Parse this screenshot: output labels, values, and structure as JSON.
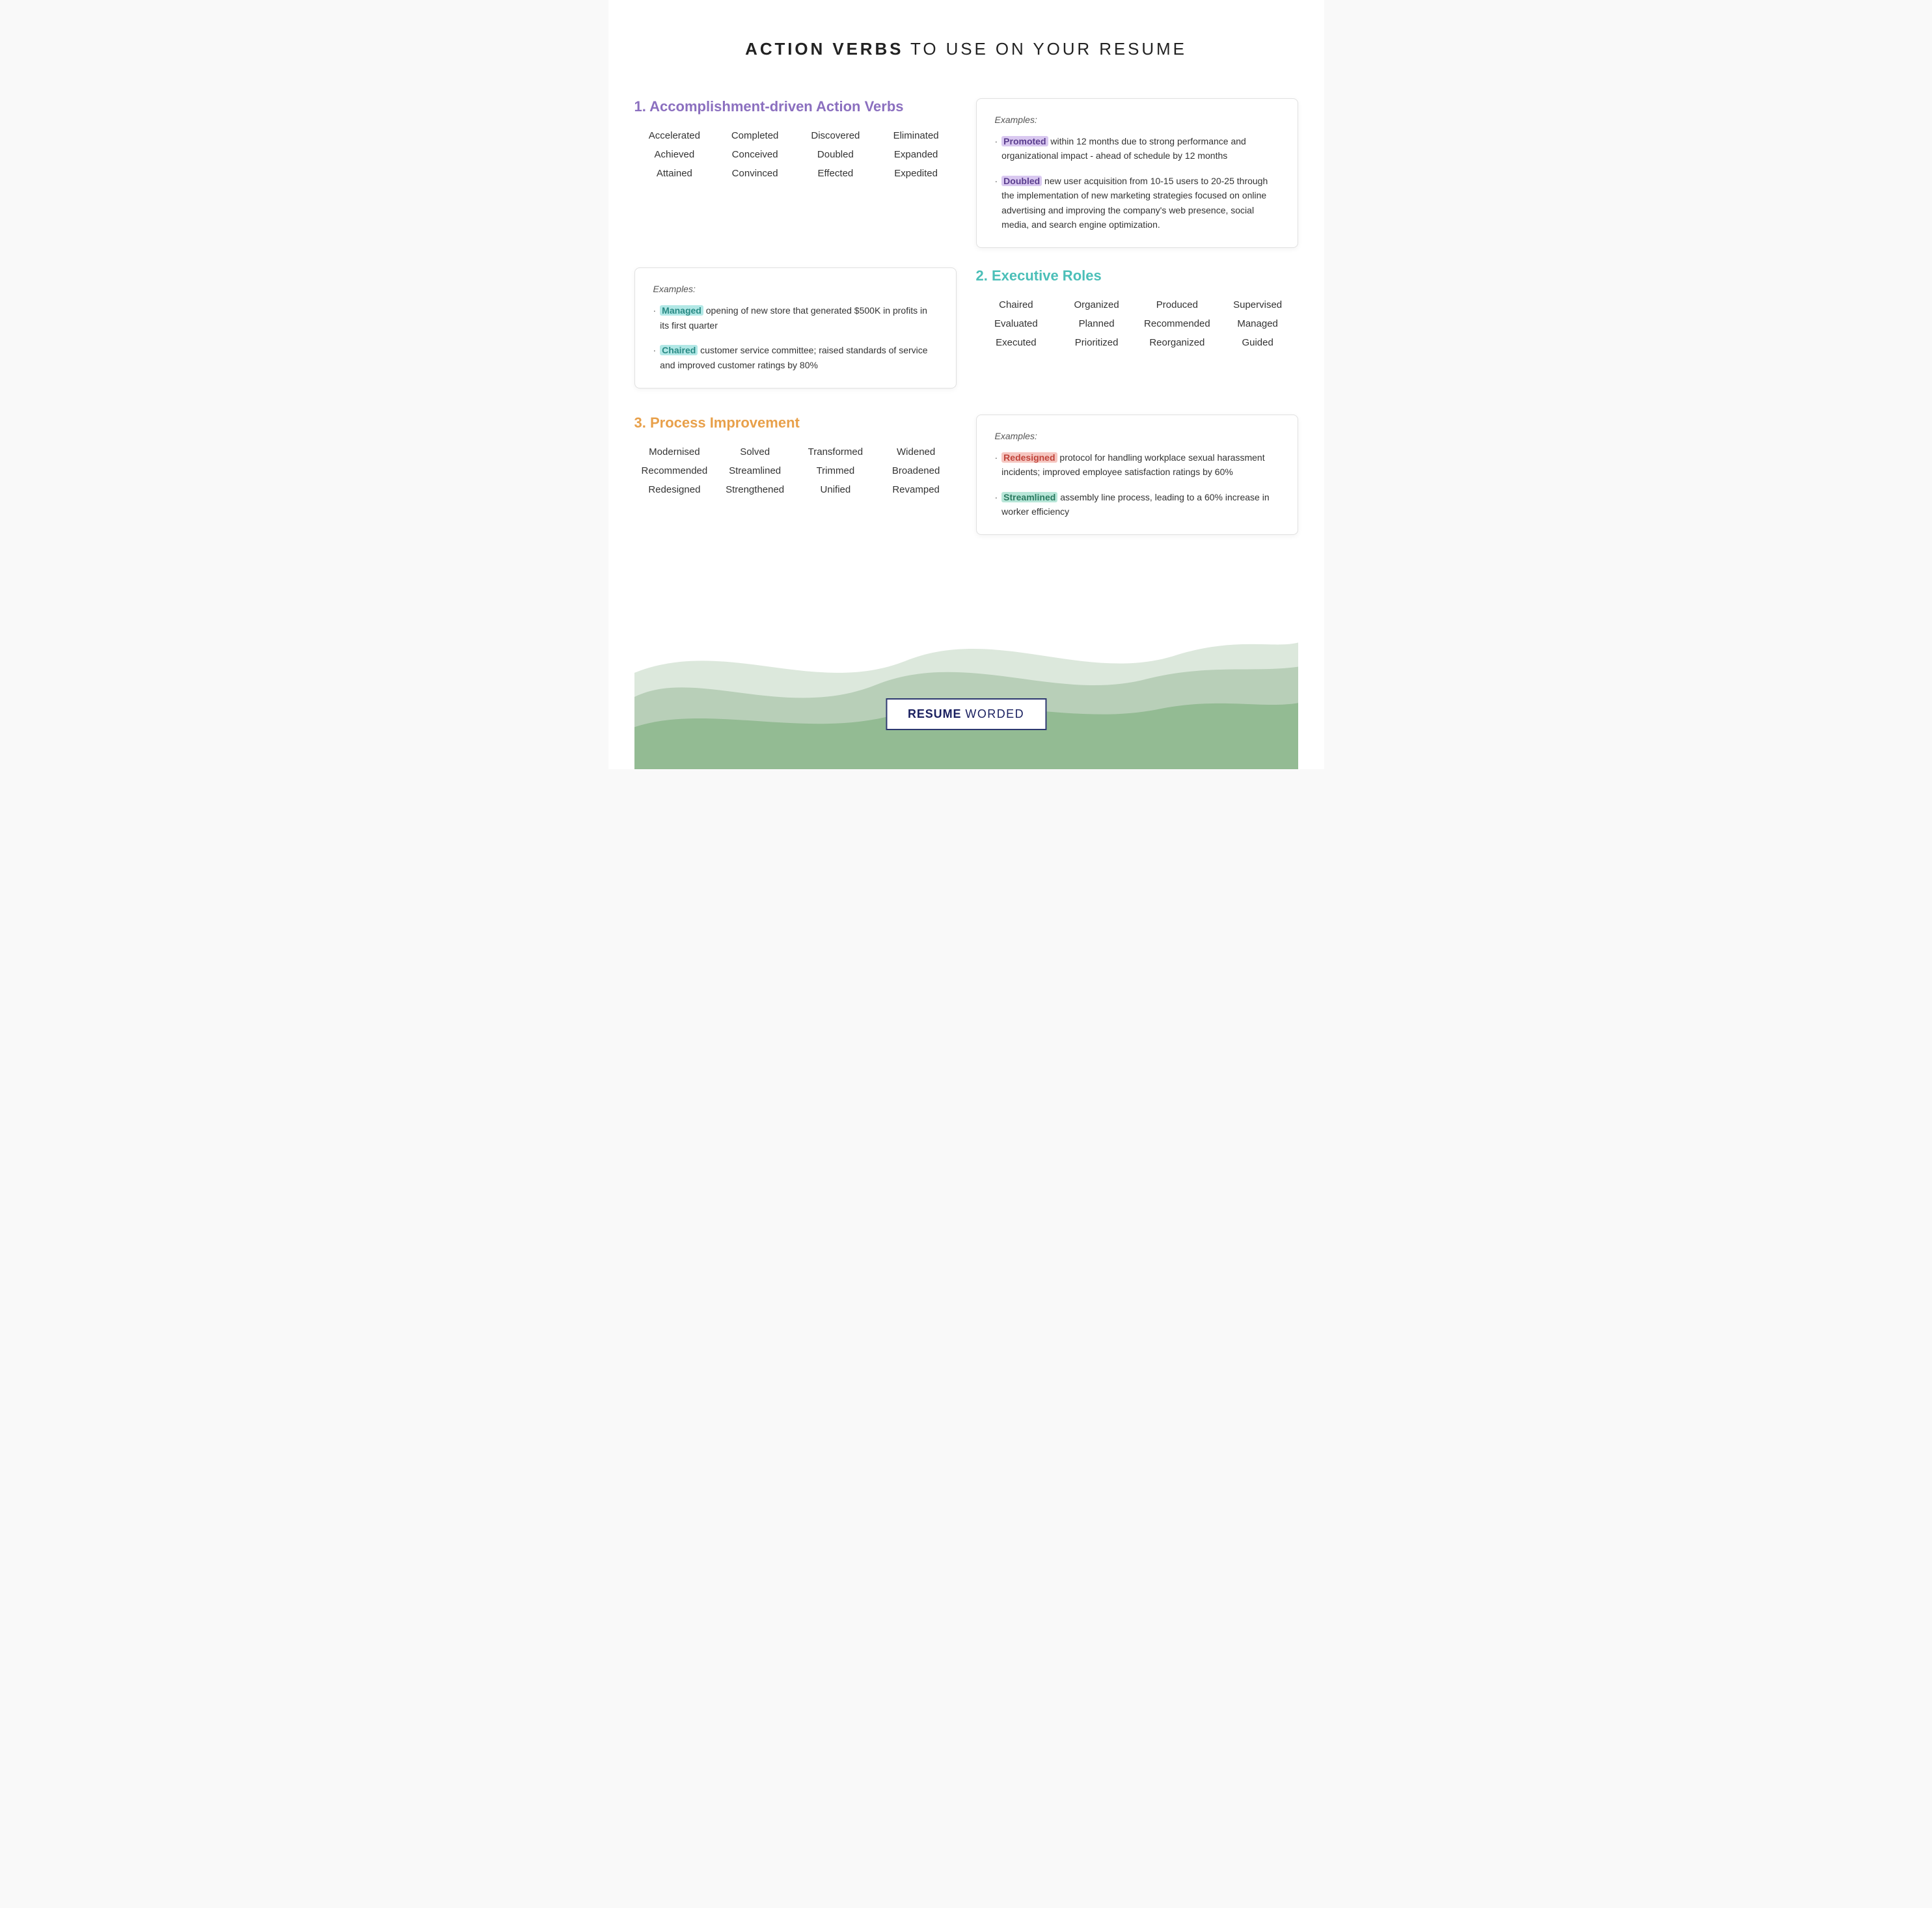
{
  "header": {
    "bold": "ACTION VERBS",
    "light": " TO USE ON YOUR RESUME"
  },
  "section1": {
    "title": "1. Accomplishment-driven Action Verbs",
    "title_color": "purple",
    "words": [
      [
        "Accelerated",
        "Achieved",
        "Attained"
      ],
      [
        "Completed",
        "Conceived",
        "Convinced"
      ],
      [
        "Discovered",
        "Doubled",
        "Effected"
      ],
      [
        "Eliminated",
        "Expanded",
        "Expedited"
      ]
    ],
    "examples_label": "Examples:",
    "examples": [
      {
        "highlight": "Promoted",
        "highlight_class": "purple",
        "text": " within 12 months due to strong performance and organizational impact - ahead of schedule by 12 months"
      },
      {
        "highlight": "Doubled",
        "highlight_class": "purple",
        "text": " new user acquisition from 10-15 users to 20-25 through the implementation of new marketing strategies focused on online advertising and improving the company's web presence, social media, and search engine optimization."
      }
    ]
  },
  "section1_left_example": {
    "examples_label": "Examples:",
    "examples": [
      {
        "highlight": "Managed",
        "highlight_class": "teal",
        "text": " opening of new store that generated $500K in profits in its first quarter"
      },
      {
        "highlight": "Chaired",
        "highlight_class": "teal",
        "text": " customer service committee; raised standards of service and improved customer ratings by 80%"
      }
    ]
  },
  "section2": {
    "title": "2. Executive Roles",
    "title_color": "teal",
    "words": [
      [
        "Chaired",
        "Evaluated",
        "Executed"
      ],
      [
        "Organized",
        "Planned",
        "Prioritized"
      ],
      [
        "Produced",
        "Recommended",
        "Reorganized"
      ],
      [
        "Supervised",
        "Managed",
        "Guided"
      ]
    ]
  },
  "section3": {
    "title": "3. Process Improvement",
    "title_color": "orange",
    "words": [
      [
        "Modernised",
        "Recommended",
        "Redesigned"
      ],
      [
        "Solved",
        "Streamlined",
        "Strengthened"
      ],
      [
        "Transformed",
        "Trimmed",
        "Unified"
      ],
      [
        "Widened",
        "Broadened",
        "Revamped"
      ]
    ],
    "examples_label": "Examples:",
    "examples": [
      {
        "highlight": "Redesigned",
        "highlight_class": "pink",
        "text": " protocol for handling workplace sexual harassment incidents; improved employee satisfaction ratings by 60%"
      },
      {
        "highlight": "Streamlined",
        "highlight_class": "green",
        "text": " assembly line process, leading to a 60% increase in worker efficiency"
      }
    ]
  },
  "logo": {
    "resume": "RESUME",
    "worded": "WORDED"
  }
}
